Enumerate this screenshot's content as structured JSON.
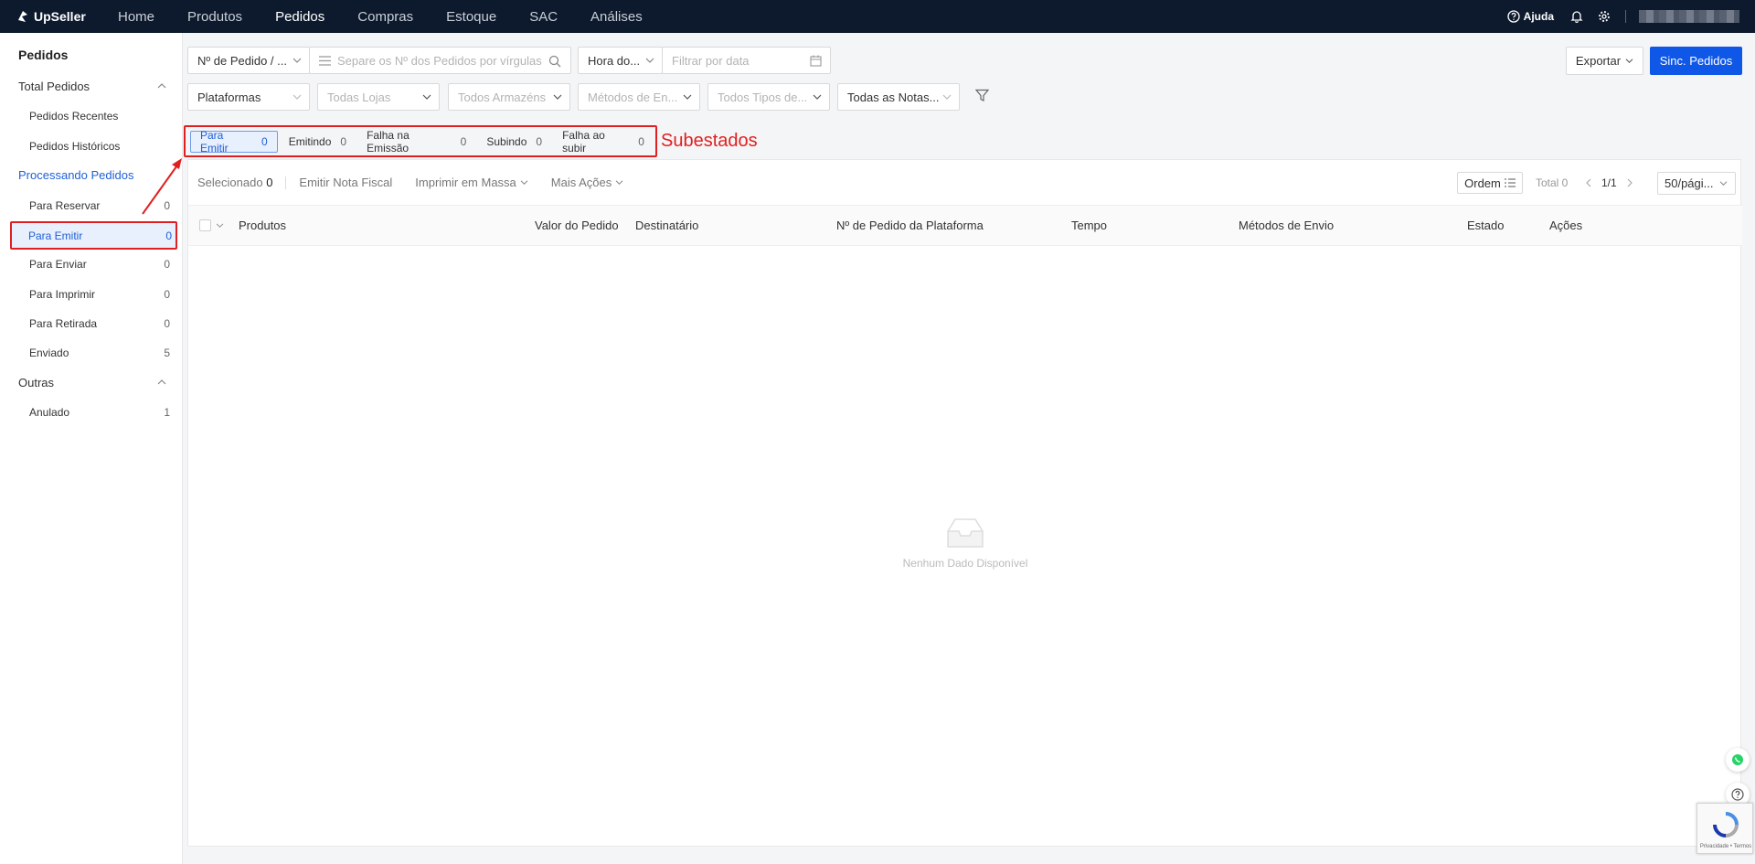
{
  "topnav": {
    "logo": "UpSeller",
    "items": [
      "Home",
      "Produtos",
      "Pedidos",
      "Compras",
      "Estoque",
      "SAC",
      "Análises"
    ],
    "active": "Pedidos",
    "help": "Ajuda"
  },
  "sidebar": {
    "title": "Pedidos",
    "group_total": "Total Pedidos",
    "recentes": "Pedidos Recentes",
    "historicos": "Pedidos Históricos",
    "group_processando": "Processando Pedidos",
    "items": [
      {
        "label": "Para Reservar",
        "count": "0"
      },
      {
        "label": "Para Emitir",
        "count": "0"
      },
      {
        "label": "Para Enviar",
        "count": "0"
      },
      {
        "label": "Para Imprimir",
        "count": "0"
      },
      {
        "label": "Para Retirada",
        "count": "0"
      },
      {
        "label": "Enviado",
        "count": "5"
      }
    ],
    "group_outras": "Outras",
    "outras_items": [
      {
        "label": "Anulado",
        "count": "1"
      }
    ]
  },
  "filters": {
    "order_type": "Nº de Pedido / ...",
    "search_placeholder": "Separe os Nº dos Pedidos por vírgulas",
    "time_type": "Hora do...",
    "date_placeholder": "Filtrar por data",
    "plataformas": "Plataformas",
    "lojas": "Todas Lojas",
    "armazens": "Todos Armazéns",
    "metodos": "Métodos de En...",
    "tipos": "Todos Tipos de...",
    "notas": "Todas as Notas..."
  },
  "actions": {
    "exportar": "Exportar",
    "sinc": "Sinc. Pedidos"
  },
  "subtabs": [
    {
      "label": "Para Emitir",
      "count": "0"
    },
    {
      "label": "Emitindo",
      "count": "0"
    },
    {
      "label": "Falha na Emissão",
      "count": "0"
    },
    {
      "label": "Subindo",
      "count": "0"
    },
    {
      "label": "Falha ao subir",
      "count": "0"
    }
  ],
  "annotation": "Subestados",
  "toolbar": {
    "selecionado": "Selecionado",
    "selecionado_count": "0",
    "emitir": "Emitir Nota Fiscal",
    "imprimir": "Imprimir em Massa",
    "mais": "Mais Ações",
    "ordem": "Ordem",
    "total": "Total 0",
    "page": "1/1",
    "perpage": "50/pági..."
  },
  "table": {
    "columns": [
      "Produtos",
      "Valor do Pedido",
      "Destinatário",
      "Nº de Pedido da Plataforma",
      "Tempo",
      "Métodos de Envio",
      "Estado",
      "Ações"
    ]
  },
  "empty": "Nenhum Dado Disponível",
  "recaptcha": "Privacidade • Termos",
  "colors": {
    "accent": "#0f57e6",
    "nav_bg": "#0d1a2d",
    "highlight": "#e02020"
  }
}
